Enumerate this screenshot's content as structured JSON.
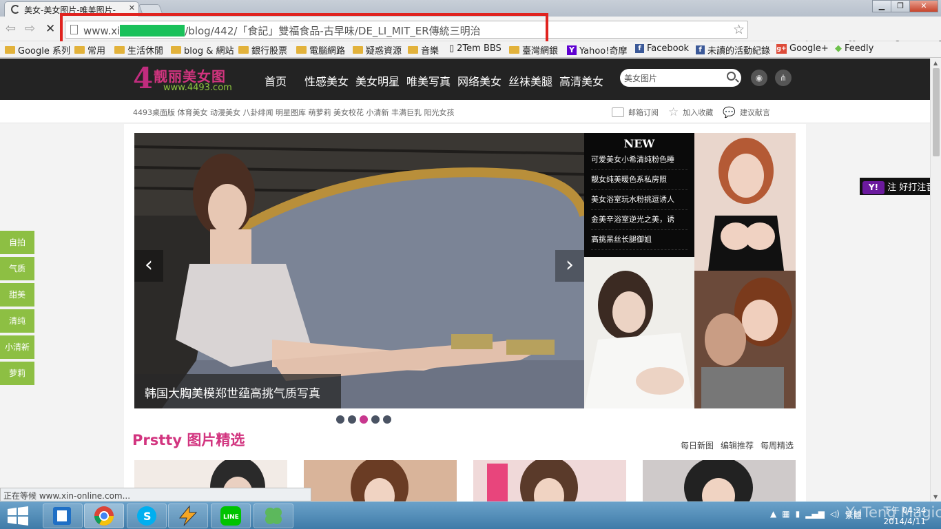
{
  "browser": {
    "tab_title": "美女-美女图片-唯美图片-",
    "url_prefix": "www.xi",
    "url_suffix": "/blog/442/「食記」雙福食品-古早味/DE_LI_MIT_ER傳統三明治",
    "status_text": "正在等候 www.xin-online.com..."
  },
  "bookmarks": [
    {
      "label": "Google 系列",
      "icon": "folder"
    },
    {
      "label": "常用",
      "icon": "folder"
    },
    {
      "label": "生活休閒",
      "icon": "folder"
    },
    {
      "label": "blog & 網站",
      "icon": "folder"
    },
    {
      "label": "銀行股票",
      "icon": "folder"
    },
    {
      "label": "電腦網路",
      "icon": "folder"
    },
    {
      "label": "疑惑資源",
      "icon": "folder"
    },
    {
      "label": "音樂",
      "icon": "folder"
    },
    {
      "label": "2Tem BBS",
      "icon": "page"
    },
    {
      "label": "臺灣網銀",
      "icon": "folder"
    },
    {
      "label": "Yahoo!奇摩",
      "icon": "yahoo"
    },
    {
      "label": "Facebook",
      "icon": "facebook"
    },
    {
      "label": "未讀的活動紀錄",
      "icon": "facebook"
    },
    {
      "label": "Google+",
      "icon": "googleplus"
    },
    {
      "label": "Feedly",
      "icon": "feedly"
    }
  ],
  "site": {
    "logo_mark": "4",
    "logo_title": "靓丽美女图",
    "logo_url": "www.4493.com",
    "menu": [
      "首页",
      "性感美女",
      "美女明星",
      "唯美写真",
      "网络美女",
      "丝袜美腿",
      "高清美女"
    ],
    "search_placeholder": "美女图片",
    "tags": "4493桌面版 体育美女 动漫美女 八卦绯闻 明星图库 萌萝莉 美女校花 小清新 丰满巨乳 阳光女孩",
    "sublinks": [
      "邮箱订阅",
      "加入收藏",
      "建议献言"
    ],
    "hero_caption": "韩国大胸美模郑世蕴高挑气质写真",
    "new_title": "NEW",
    "new_items": [
      "可爱美女小希清纯粉色睡",
      "靓女纯美暖色系私房照",
      "美女浴室玩水粉挑逗诱人",
      "金美辛浴室逆光之美，诱",
      "高挑黑丝长腿御姐"
    ],
    "side_buttons": [
      "自拍",
      "气质",
      "甜美",
      "清纯",
      "小清新",
      "萝莉"
    ],
    "yahoo_label": "注 好打注音",
    "section_title": "Prstty 图片精选",
    "section_tabs": [
      "每日新图",
      "编辑推荐",
      "每周精选"
    ],
    "slide_count": 5,
    "active_slide": 3
  },
  "taskbar": {
    "apps": [
      "outlook-icon",
      "chrome-icon",
      "skype-icon",
      "winamp-icon",
      "line-icon",
      "clover-icon"
    ],
    "ime": "繁體",
    "time": "下午 04:24",
    "date": "2014/4/11",
    "watermark": "YuTeng Magic"
  }
}
